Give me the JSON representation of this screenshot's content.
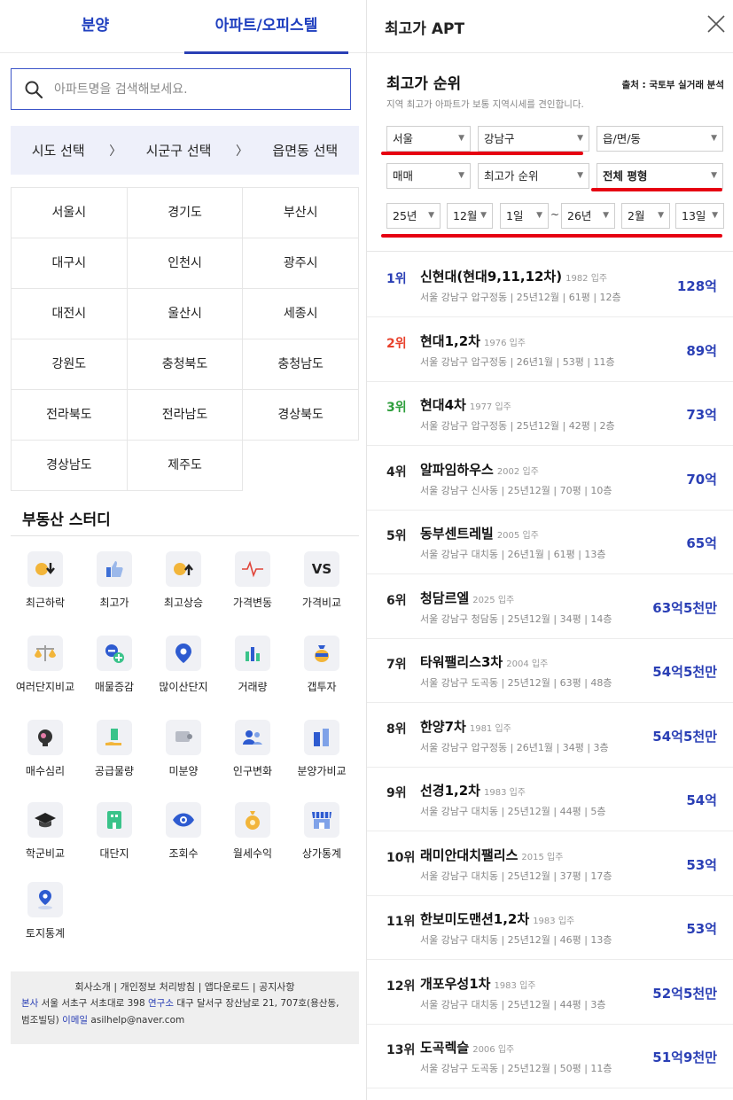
{
  "left": {
    "tabs": [
      "분양",
      "아파트/오피스텔"
    ],
    "search_placeholder": "아파트명을 검색해보세요.",
    "region_nav": [
      "시도 선택",
      "시군구 선택",
      "읍면동 선택"
    ],
    "regions": [
      [
        "서울시",
        "경기도",
        "부산시"
      ],
      [
        "대구시",
        "인천시",
        "광주시"
      ],
      [
        "대전시",
        "울산시",
        "세종시"
      ],
      [
        "강원도",
        "충청북도",
        "충청남도"
      ],
      [
        "전라북도",
        "전라남도",
        "경상북도"
      ],
      [
        "경상남도",
        "제주도",
        ""
      ]
    ],
    "study_title": "부동산 스터디",
    "tools": [
      {
        "label": "최근하락",
        "icon": "down-arrow-coin-icon"
      },
      {
        "label": "최고가",
        "icon": "thumbs-up-icon"
      },
      {
        "label": "최고상승",
        "icon": "up-arrow-coin-icon"
      },
      {
        "label": "가격변동",
        "icon": "heartbeat-icon"
      },
      {
        "label": "가격비교",
        "icon": "vs-icon"
      },
      {
        "label": "여러단지비교",
        "icon": "scale-icon"
      },
      {
        "label": "매물증감",
        "icon": "plus-minus-icon"
      },
      {
        "label": "많이산단지",
        "icon": "location-badge-icon"
      },
      {
        "label": "거래량",
        "icon": "bar-chart-icon"
      },
      {
        "label": "갭투자",
        "icon": "money-bag-icon"
      },
      {
        "label": "매수심리",
        "icon": "brain-icon"
      },
      {
        "label": "공급물량",
        "icon": "building-hand-icon"
      },
      {
        "label": "미분양",
        "icon": "sign-icon"
      },
      {
        "label": "인구변화",
        "icon": "people-icon"
      },
      {
        "label": "분양가비교",
        "icon": "building-compare-icon"
      },
      {
        "label": "학군비교",
        "icon": "graduation-cap-icon"
      },
      {
        "label": "대단지",
        "icon": "apartment-icon"
      },
      {
        "label": "조회수",
        "icon": "eye-icon"
      },
      {
        "label": "월세수익",
        "icon": "coin-bag-icon"
      },
      {
        "label": "상가통계",
        "icon": "store-icon"
      },
      {
        "label": "토지통계",
        "icon": "map-pin-icon"
      }
    ],
    "footer": {
      "links": "회사소개 | 개인정보 처리방침 | 앱다운로드 | 공지사항",
      "hq_label": "본사",
      "hq_addr": "서울 서초구 서초대로 398",
      "lab_label": "연구소",
      "lab_addr": "대구 달서구 장산남로 21, 707호(용산동, 범조빌딩)",
      "email_label": "이메일",
      "email": "asilhelp@naver.com"
    }
  },
  "right": {
    "title": "최고가 APT",
    "rank_title": "최고가 순위",
    "source": "출처 : 국토부 실거래 분석",
    "subtitle": "지역 최고가 아파트가 보통 지역시세를 견인합니다.",
    "filters": {
      "sido": "서울",
      "sigungu": "강남구",
      "dong": "읍/면/동",
      "deal": "매매",
      "order": "최고가 순위",
      "size": "전체 평형",
      "from_year": "25년",
      "from_month": "12월",
      "from_day": "1일",
      "tilde": "~",
      "to_year": "26년",
      "to_month": "2월",
      "to_day": "13일"
    },
    "ranking": [
      {
        "rank": "1위",
        "name": "신현대(현대9,11,12차)",
        "year": "1982 입주",
        "meta": "서울 강남구 압구정동 | 25년12월 | 61평 | 12층",
        "price": "128억"
      },
      {
        "rank": "2위",
        "name": "현대1,2차",
        "year": "1976 입주",
        "meta": "서울 강남구 압구정동 | 26년1월 | 53평 | 11층",
        "price": "89억"
      },
      {
        "rank": "3위",
        "name": "현대4차",
        "year": "1977 입주",
        "meta": "서울 강남구 압구정동 | 25년12월 | 42평 | 2층",
        "price": "73억"
      },
      {
        "rank": "4위",
        "name": "알파임하우스",
        "year": "2002 입주",
        "meta": "서울 강남구 신사동 | 25년12월 | 70평 | 10층",
        "price": "70억"
      },
      {
        "rank": "5위",
        "name": "동부센트레빌",
        "year": "2005 입주",
        "meta": "서울 강남구 대치동 | 26년1월 | 61평 | 13층",
        "price": "65억"
      },
      {
        "rank": "6위",
        "name": "청담르엘",
        "year": "2025 입주",
        "meta": "서울 강남구 청담동 | 25년12월 | 34평 | 14층",
        "price": "63억5천만"
      },
      {
        "rank": "7위",
        "name": "타워팰리스3차",
        "year": "2004 입주",
        "meta": "서울 강남구 도곡동 | 25년12월 | 63평 | 48층",
        "price": "54억5천만"
      },
      {
        "rank": "8위",
        "name": "한양7차",
        "year": "1981 입주",
        "meta": "서울 강남구 압구정동 | 26년1월 | 34평 | 3층",
        "price": "54억5천만"
      },
      {
        "rank": "9위",
        "name": "선경1,2차",
        "year": "1983 입주",
        "meta": "서울 강남구 대치동 | 25년12월 | 44평 | 5층",
        "price": "54억"
      },
      {
        "rank": "10위",
        "name": "래미안대치팰리스",
        "year": "2015 입주",
        "meta": "서울 강남구 대치동 | 25년12월 | 37평 | 17층",
        "price": "53억"
      },
      {
        "rank": "11위",
        "name": "한보미도맨션1,2차",
        "year": "1983 입주",
        "meta": "서울 강남구 대치동 | 25년12월 | 46평 | 13층",
        "price": "53억"
      },
      {
        "rank": "12위",
        "name": "개포우성1차",
        "year": "1983 입주",
        "meta": "서울 강남구 대치동 | 25년12월 | 44평 | 3층",
        "price": "52억5천만"
      },
      {
        "rank": "13위",
        "name": "도곡렉슬",
        "year": "2006 입주",
        "meta": "서울 강남구 도곡동 | 25년12월 | 50평 | 11층",
        "price": "51억9천만"
      }
    ],
    "rank_colors": {
      "1": "#2a3fb5",
      "2": "#e8412c",
      "3": "#2e9e3c",
      "other": "#222222"
    },
    "accent": "#2a3fb5",
    "annotation_color": "#e60012"
  }
}
